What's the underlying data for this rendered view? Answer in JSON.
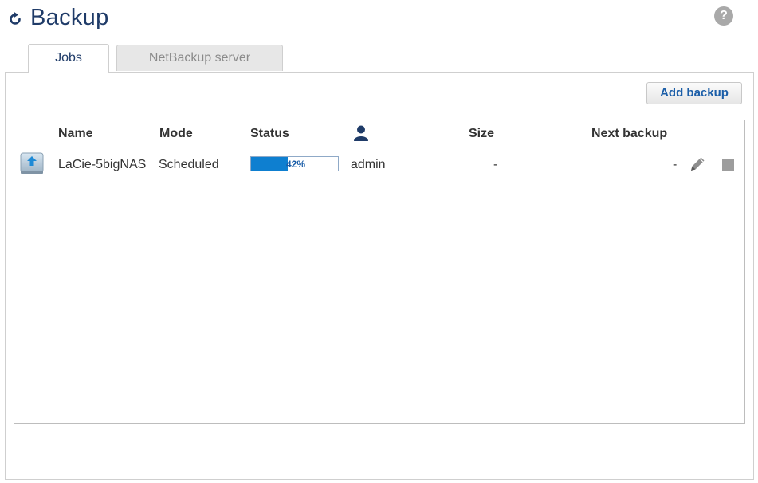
{
  "header": {
    "title": "Backup",
    "help_label": "?"
  },
  "tabs": [
    {
      "label": "Jobs",
      "active": true
    },
    {
      "label": "NetBackup server",
      "active": false
    }
  ],
  "toolbar": {
    "add_backup_label": "Add backup"
  },
  "table": {
    "columns": {
      "name": "Name",
      "mode": "Mode",
      "status": "Status",
      "user_icon": "user-icon",
      "size": "Size",
      "next_backup": "Next backup"
    },
    "rows": [
      {
        "icon": "nas-device-icon",
        "name": "LaCie-5bigNAS",
        "mode": "Scheduled",
        "progress": 0.42,
        "progress_label": "42%",
        "user": "admin",
        "size": "-",
        "next_backup": "-"
      }
    ]
  },
  "colors": {
    "title": "#1f3b68",
    "accent": "#1b5ea8",
    "progress_fill": "#0e7fd0"
  }
}
